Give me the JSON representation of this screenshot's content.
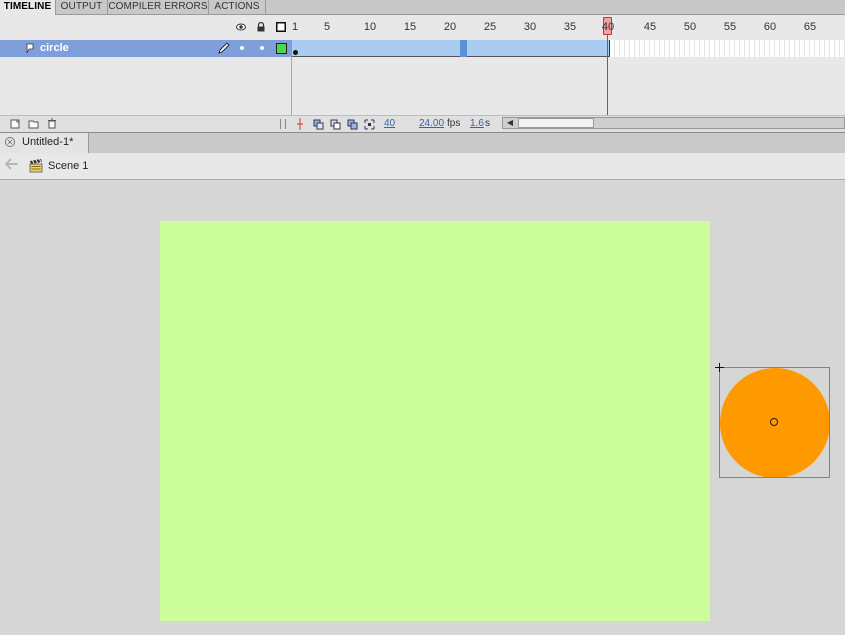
{
  "panel_tabs": [
    "TIMELINE",
    "OUTPUT",
    "COMPILER ERRORS",
    "ACTIONS"
  ],
  "timeline": {
    "frame_numbers": [
      "1",
      "5",
      "10",
      "15",
      "20",
      "25",
      "30",
      "35",
      "40",
      "45",
      "50",
      "55",
      "60",
      "65"
    ],
    "current_frame_marker": "40",
    "layer": {
      "name": "circle"
    },
    "footer": {
      "current_frame": "40",
      "fps": "24.00",
      "fps_unit": "fps",
      "elapsed": "1.6",
      "elapsed_unit": "s"
    }
  },
  "document": {
    "tab_title": "Untitled-1*",
    "close_glyph": "×"
  },
  "editbar": {
    "scene_label": "Scene 1"
  },
  "stage": {
    "background_color": "#ccff99"
  },
  "symbol": {
    "shape": "circle",
    "fill_color": "#ff9900",
    "selection_color": "#4a90d9"
  },
  "icons": {
    "eye": "eye-icon",
    "lock": "lock-icon",
    "outline": "outline-icon",
    "pencil": "pencil-icon",
    "layer": "layer-icon",
    "new_layer": "new-layer-icon",
    "new_folder": "new-folder-icon",
    "delete": "trash-icon",
    "scene": "clapperboard-icon",
    "back": "back-arrow-icon"
  }
}
